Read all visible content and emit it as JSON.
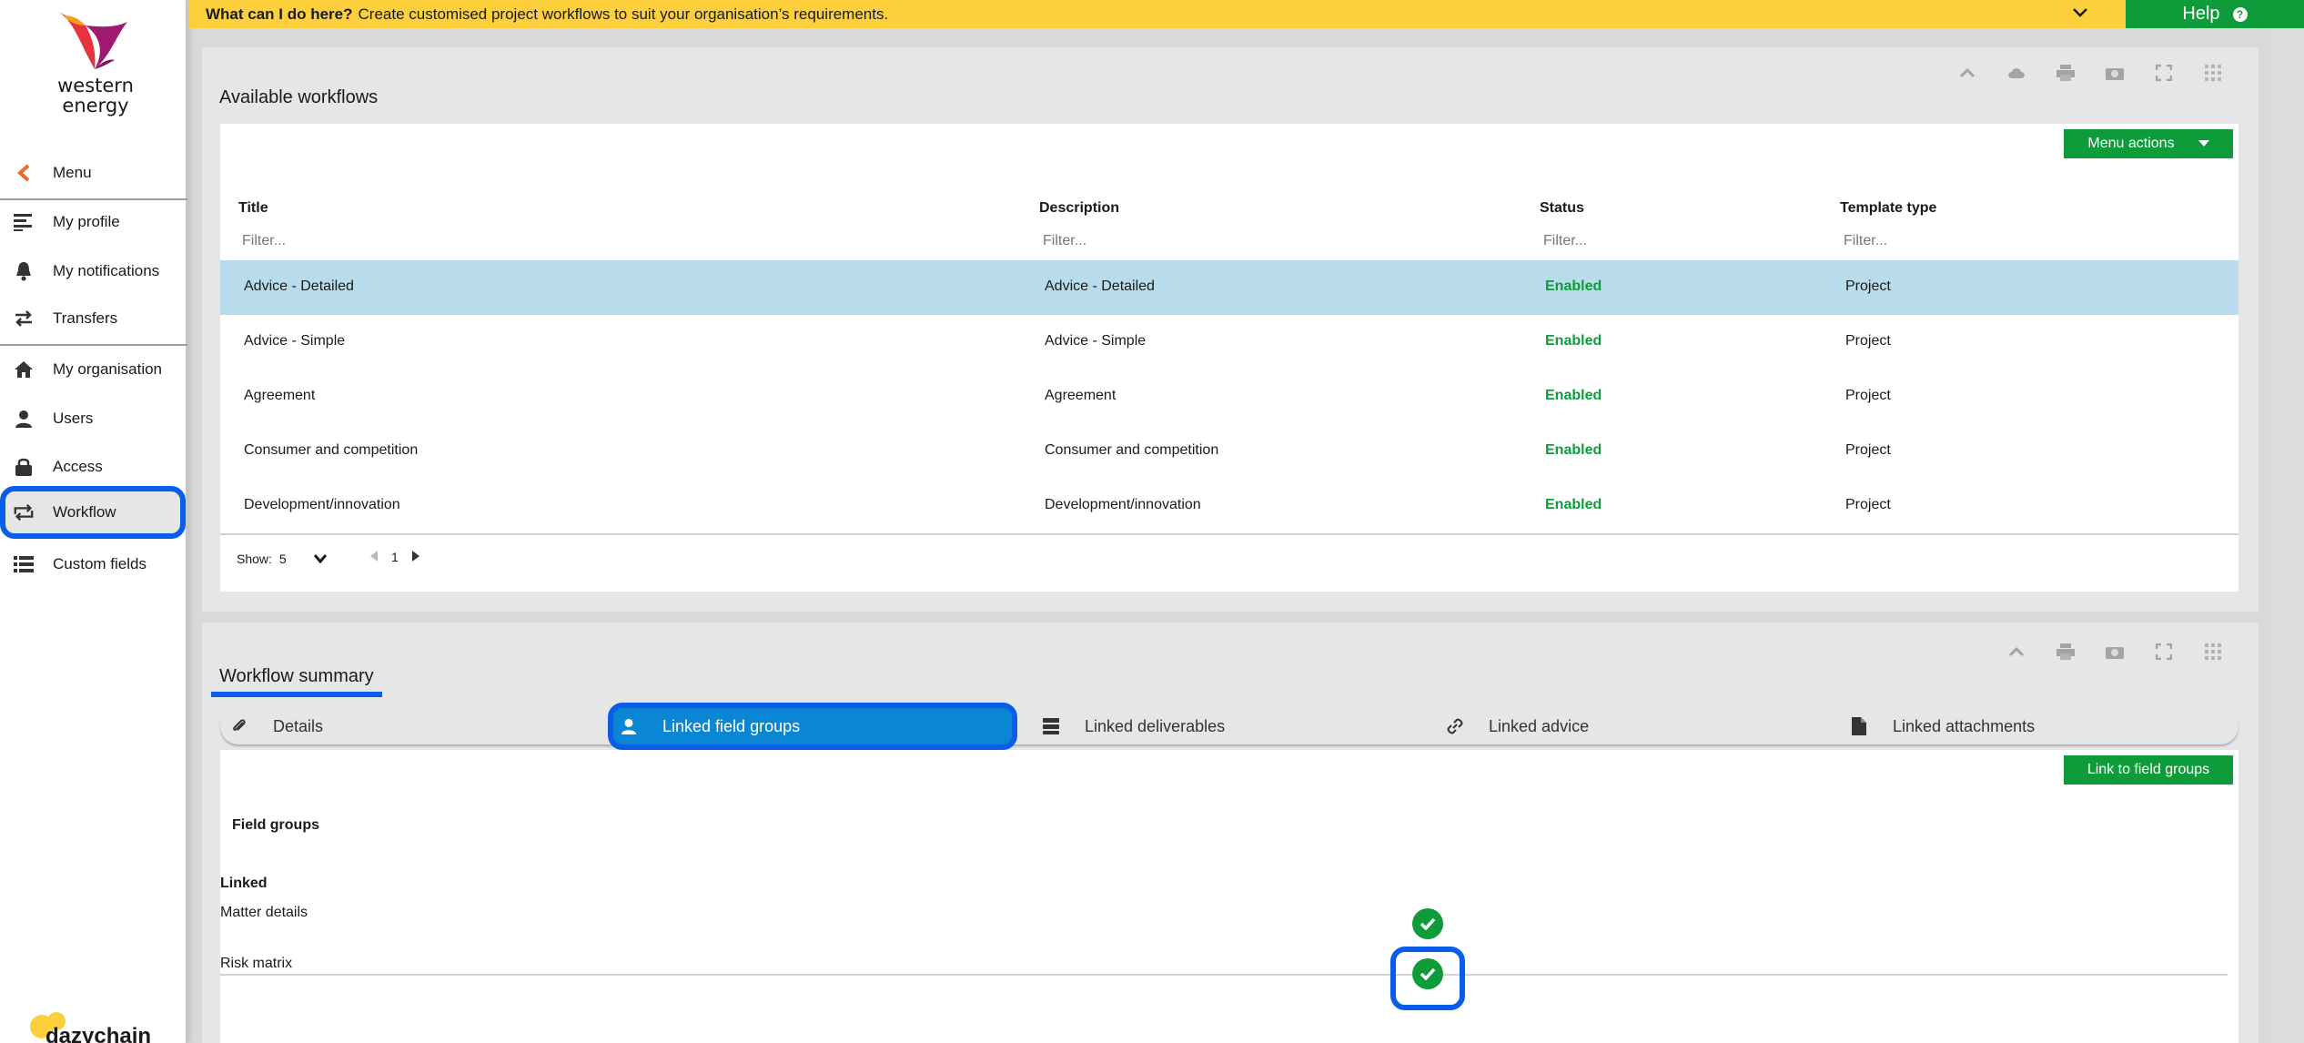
{
  "brand": {
    "name_line1": "western",
    "name_line2": "energy",
    "footer_logo": "dazychain"
  },
  "topbar": {
    "bold": "What can I do here?",
    "text": "Create customised project workflows to suit your organisation’s requirements.",
    "help_label": "Help"
  },
  "sidebar": {
    "items": [
      {
        "label": "Menu",
        "icon": "chevron-left-icon"
      },
      {
        "label": "My profile",
        "icon": "lines-icon"
      },
      {
        "label": "My notifications",
        "icon": "bell-icon"
      },
      {
        "label": "Transfers",
        "icon": "transfer-arrows-icon"
      },
      {
        "label": "My organisation",
        "icon": "home-icon"
      },
      {
        "label": "Users",
        "icon": "user-icon"
      },
      {
        "label": "Access",
        "icon": "lock-icon"
      },
      {
        "label": "Workflow",
        "icon": "workflow-icon"
      },
      {
        "label": "Custom fields",
        "icon": "list-icon"
      }
    ]
  },
  "workflows": {
    "title": "Available workflows",
    "menu_actions": "Menu actions",
    "columns": [
      "Title",
      "Description",
      "Status",
      "Template type"
    ],
    "filter_placeholder": "Filter...",
    "rows": [
      {
        "title": "Advice - Detailed",
        "description": "Advice - Detailed",
        "status": "Enabled",
        "type": "Project"
      },
      {
        "title": "Advice - Simple",
        "description": "Advice - Simple",
        "status": "Enabled",
        "type": "Project"
      },
      {
        "title": "Agreement",
        "description": "Agreement",
        "status": "Enabled",
        "type": "Project"
      },
      {
        "title": "Consumer and competition",
        "description": "Consumer and competition",
        "status": "Enabled",
        "type": "Project"
      },
      {
        "title": "Development/innovation",
        "description": "Development/innovation",
        "status": "Enabled",
        "type": "Project"
      }
    ],
    "show_label": "Show:",
    "show_value": "5",
    "page": "1"
  },
  "summary": {
    "title": "Workflow summary",
    "tabs": [
      "Details",
      "Linked field groups",
      "Linked deliverables",
      "Linked advice",
      "Linked attachments"
    ],
    "link_button": "Link to field groups",
    "section_title": "Field groups",
    "linked_header": "Linked",
    "field_groups": [
      {
        "name": "Matter details",
        "linked": true
      },
      {
        "name": "Risk matrix",
        "linked": true
      }
    ]
  },
  "colors": {
    "accent_green": "#0e9c3b",
    "highlight_blue": "#0a5de8",
    "banner_yellow": "#fdd03b",
    "selected_row": "#b9dcec",
    "active_tab": "#0a86d4"
  }
}
